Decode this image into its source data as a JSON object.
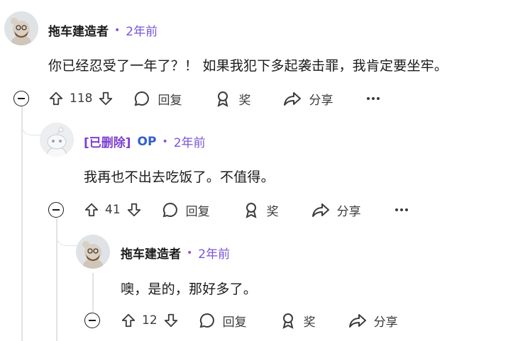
{
  "comments": [
    {
      "author": "拖车建造者",
      "time": "2年前",
      "text": "你已经忍受了一年了？！ 如果我犯下多起袭击罪，我肯定要坐牢。",
      "votes": "118",
      "reply_label": "回复",
      "award_label": "奖",
      "share_label": "分享"
    },
    {
      "author": "[已删除]",
      "op_badge": "OP",
      "time": "2年前",
      "text": "我再也不出去吃饭了。不值得。",
      "votes": "41",
      "reply_label": "回复",
      "award_label": "奖",
      "share_label": "分享"
    },
    {
      "author": "拖车建造者",
      "time": "2年前",
      "text": "噢，是的，那好多了。",
      "votes": "12",
      "reply_label": "回复",
      "award_label": "奖",
      "share_label": "分享"
    }
  ],
  "separator": "•",
  "icons": [
    "upvote-icon",
    "downvote-icon",
    "comment-icon",
    "award-icon",
    "share-icon",
    "more-icon",
    "collapse-icon"
  ]
}
